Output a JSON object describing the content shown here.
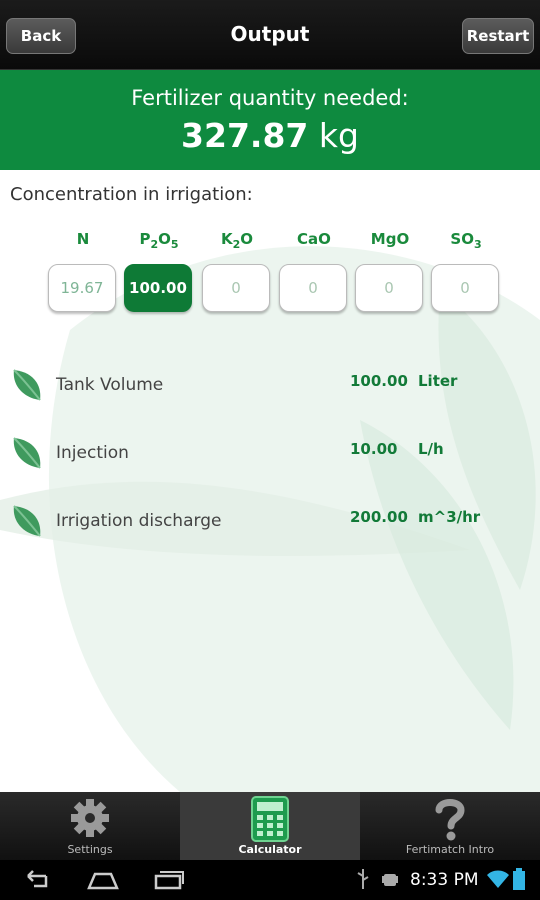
{
  "header": {
    "back_label": "Back",
    "title": "Output",
    "restart_label": "Restart"
  },
  "result": {
    "label": "Fertilizer quantity needed:",
    "value": "327.87",
    "unit": "kg"
  },
  "concentration": {
    "title": "Concentration in irrigation:",
    "nutrients": [
      {
        "base": "N",
        "parts": [
          [
            "N",
            ""
          ]
        ],
        "value": "19.67"
      },
      {
        "base": "P2O5",
        "parts": [
          [
            "P",
            "2"
          ],
          [
            "O",
            "5"
          ]
        ],
        "value": "100.00"
      },
      {
        "base": "K2O",
        "parts": [
          [
            "K",
            "2"
          ],
          [
            "O",
            ""
          ]
        ],
        "value": "0"
      },
      {
        "base": "CaO",
        "parts": [
          [
            "CaO",
            ""
          ]
        ],
        "value": "0"
      },
      {
        "base": "MgO",
        "parts": [
          [
            "MgO",
            ""
          ]
        ],
        "value": "0"
      },
      {
        "base": "SO3",
        "parts": [
          [
            "SO",
            "3"
          ]
        ],
        "value": "0"
      }
    ]
  },
  "rows": [
    {
      "label": "Tank Volume",
      "value": "100.00",
      "unit": "Liter"
    },
    {
      "label": "Injection",
      "value": "10.00",
      "unit": "L/h"
    },
    {
      "label": "Irrigation discharge",
      "value": "200.00",
      "unit": "m^3/hr"
    }
  ],
  "tabs": {
    "settings": "Settings",
    "calculator": "Calculator",
    "intro": "Fertimatch Intro"
  },
  "status": {
    "time": "8:33 PM"
  },
  "colors": {
    "brand_green": "#0e8a3f",
    "value_green": "#127a38"
  }
}
